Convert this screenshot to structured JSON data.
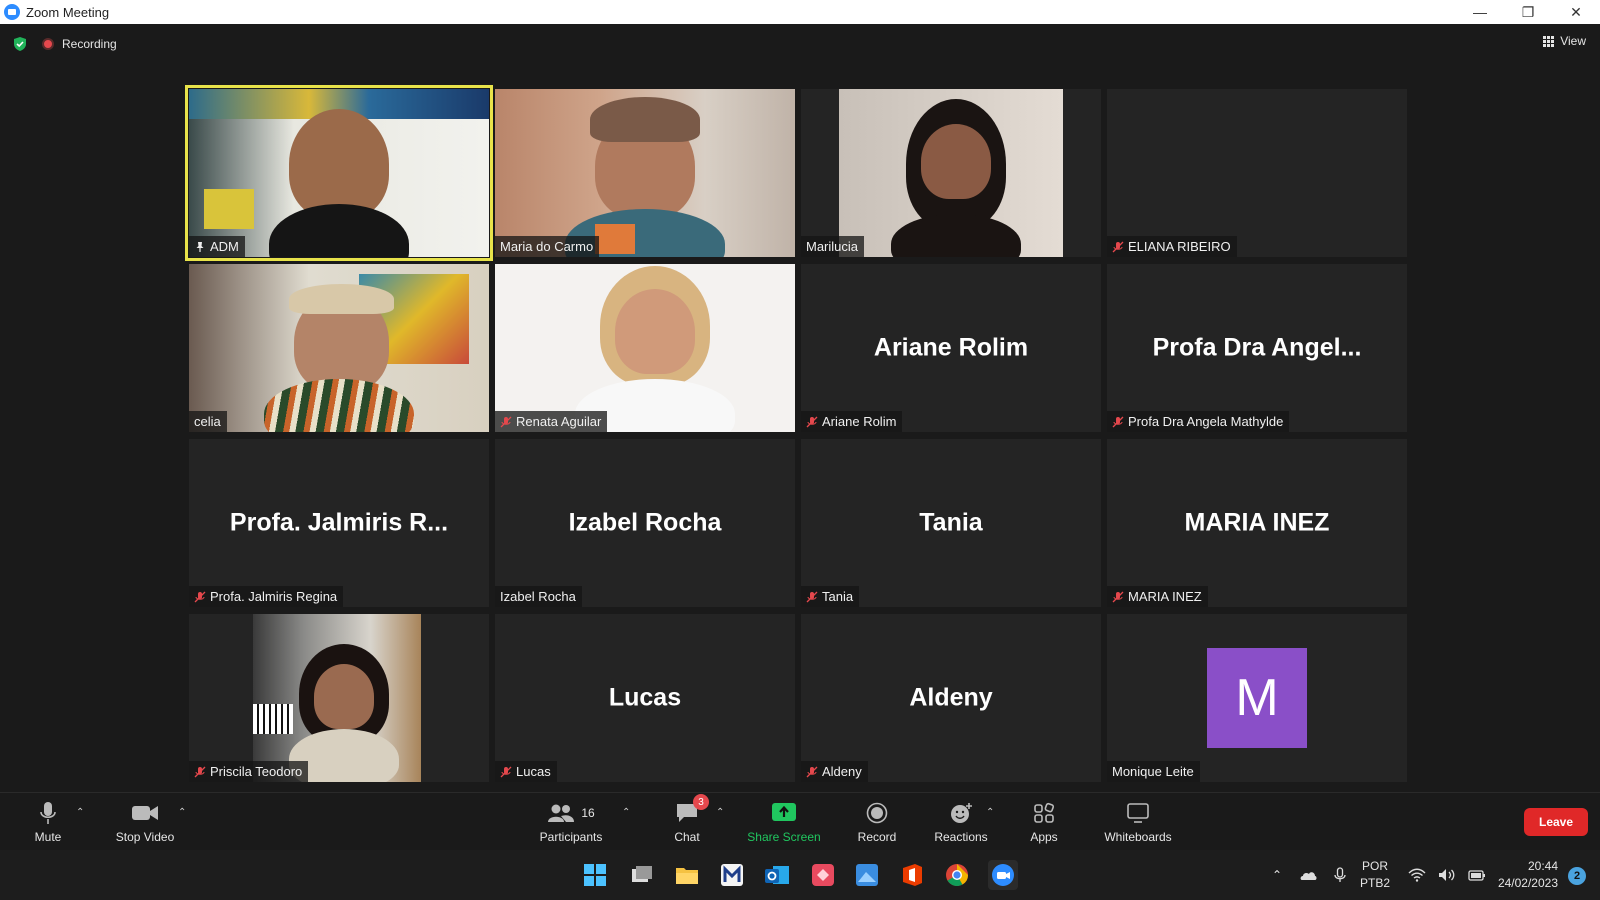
{
  "window": {
    "title": "Zoom Meeting"
  },
  "meeting": {
    "recording_label": "Recording",
    "view_label": "View"
  },
  "tiles": [
    {
      "name": "ADM",
      "big": "",
      "video": true,
      "muted": false,
      "pinned": true,
      "active": true
    },
    {
      "name": "Maria do Carmo",
      "big": "",
      "video": true,
      "muted": false
    },
    {
      "name": "Marilucia",
      "big": "",
      "video": true,
      "muted": false
    },
    {
      "name": "ELIANA RIBEIRO",
      "big": "",
      "video": false,
      "muted": true
    },
    {
      "name": "celia",
      "big": "",
      "video": true,
      "muted": false
    },
    {
      "name": "Renata Aguilar",
      "big": "",
      "video": true,
      "muted": true
    },
    {
      "name": "Ariane Rolim",
      "big": "Ariane Rolim",
      "video": false,
      "muted": true
    },
    {
      "name": "Profa Dra Angela Mathylde",
      "big": "Profa Dra Angel...",
      "video": false,
      "muted": true
    },
    {
      "name": "Profa. Jalmiris Regina",
      "big": "Profa. Jalmiris R...",
      "video": false,
      "muted": true
    },
    {
      "name": "Izabel Rocha",
      "big": "Izabel Rocha",
      "video": false,
      "muted": false
    },
    {
      "name": "Tania",
      "big": "Tania",
      "video": false,
      "muted": true
    },
    {
      "name": "MARIA INEZ",
      "big": "MARIA INEZ",
      "video": false,
      "muted": true
    },
    {
      "name": "Priscila Teodoro",
      "big": "",
      "video": true,
      "muted": true
    },
    {
      "name": "Lucas",
      "big": "Lucas",
      "video": false,
      "muted": true
    },
    {
      "name": "Aldeny",
      "big": "Aldeny",
      "video": false,
      "muted": true
    },
    {
      "name": "Monique Leite",
      "big": "",
      "video": false,
      "muted": false,
      "avatar_letter": "M"
    }
  ],
  "toolbar": {
    "mute": "Mute",
    "stop_video": "Stop Video",
    "participants": "Participants",
    "participants_count": "16",
    "chat": "Chat",
    "chat_badge": "3",
    "share_screen": "Share Screen",
    "record": "Record",
    "reactions": "Reactions",
    "apps": "Apps",
    "whiteboards": "Whiteboards",
    "leave": "Leave"
  },
  "taskbar": {
    "lang_1": "POR",
    "lang_2": "PTB2",
    "time": "20:44",
    "date": "24/02/2023",
    "notifications": "2"
  },
  "colors": {
    "active_speaker": "#e8e34a",
    "leave": "#e02828",
    "share": "#20c65f",
    "avatar": "#8a4fc8"
  }
}
